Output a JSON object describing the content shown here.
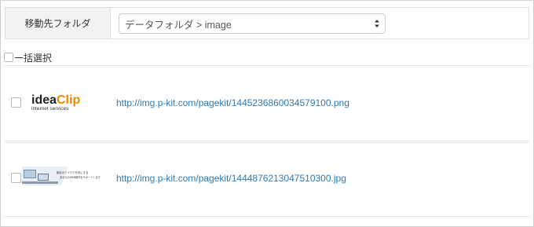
{
  "folder": {
    "label": "移動先フォルダ",
    "selected": "データフォルダ > image"
  },
  "select_all": {
    "label": "一括選択",
    "checked": false
  },
  "items": [
    {
      "thumbnail": {
        "type": "logo",
        "brand_left": "idea",
        "brand_right": "Clip",
        "tagline": "internet services",
        "colors": {
          "dark": "#222222",
          "accent": "#f08c00"
        }
      },
      "url": "http://img.p-kit.com/pagekit/1445236860034579100.png",
      "checked": false
    },
    {
      "thumbnail": {
        "type": "banner",
        "line1": "御社のアイデアを形にする",
        "line2": "あなたのWEB制作をサポートします"
      },
      "url": "http://img.p-kit.com/pagekit/1444876213047510300.jpg",
      "checked": false
    }
  ],
  "colors": {
    "link": "#2d7ab5",
    "label_bg": "#f2f2f2",
    "border": "#dddddd"
  }
}
